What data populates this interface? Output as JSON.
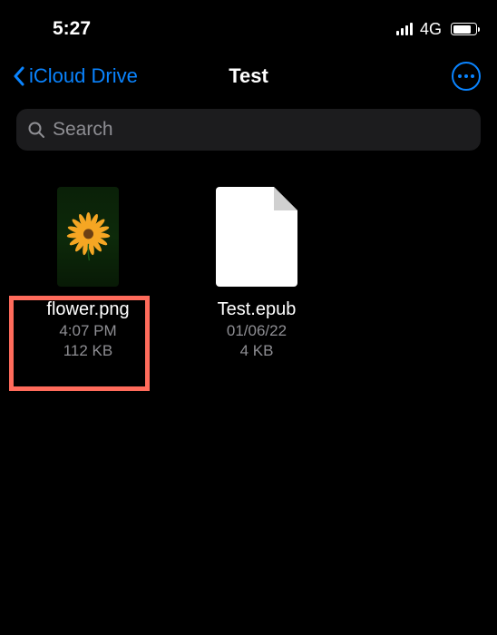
{
  "status": {
    "time": "5:27",
    "network": "4G"
  },
  "nav": {
    "back_label": "iCloud Drive",
    "title": "Test"
  },
  "search": {
    "placeholder": "Search"
  },
  "files": [
    {
      "name": "flower.png",
      "time": "4:07 PM",
      "size": "112 KB"
    },
    {
      "name": "Test.epub",
      "time": "01/06/22",
      "size": "4 KB"
    }
  ]
}
